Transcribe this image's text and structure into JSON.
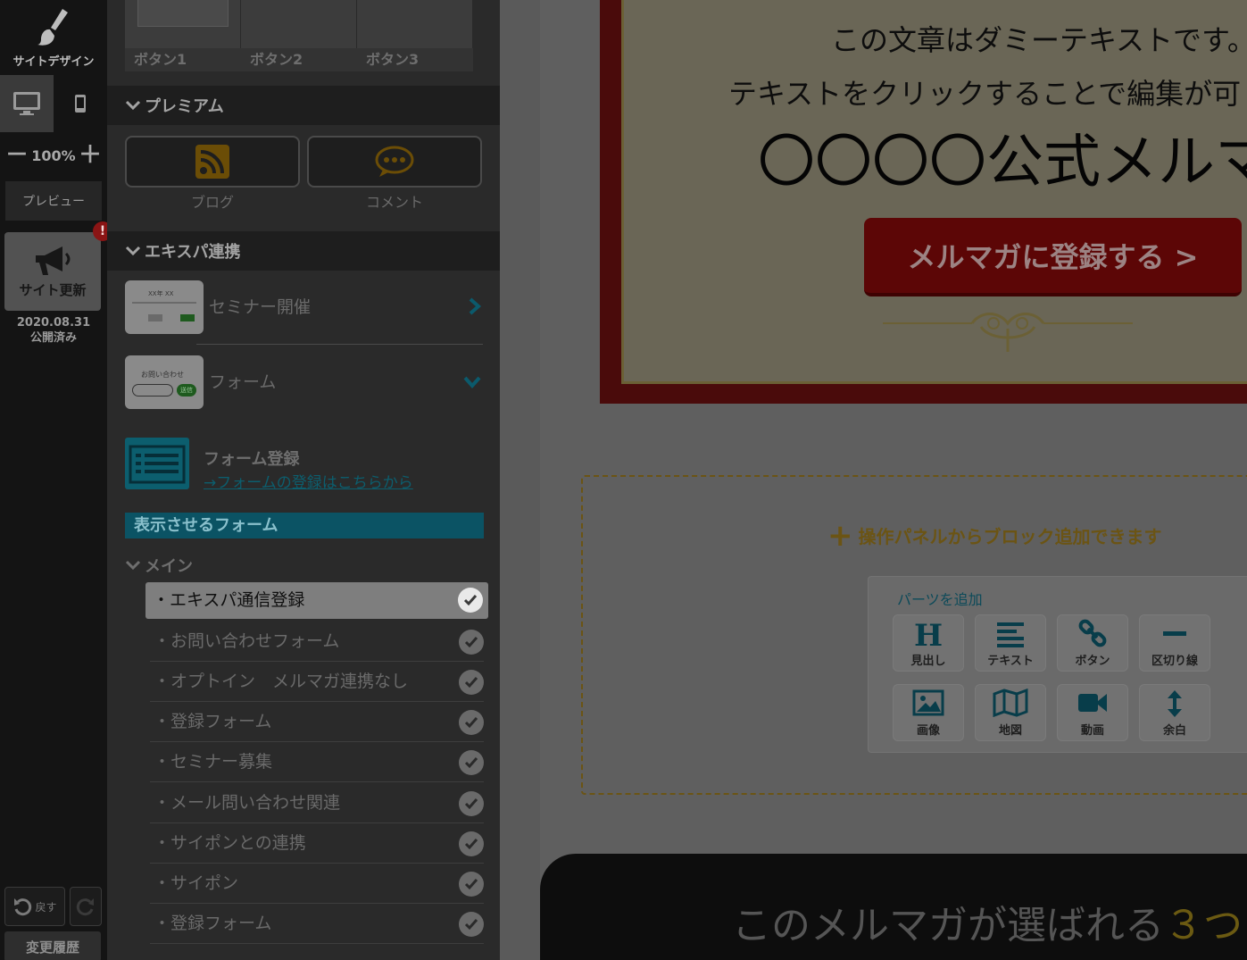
{
  "toolbar": {
    "design_label": "サイトデザイン",
    "zoom": "100%",
    "zoom_minus": "－",
    "zoom_plus": "＋",
    "preview_label": "プレビュー",
    "update_label": "サイト更新",
    "alert_badge": "!",
    "publish_date": "2020.08.31",
    "publish_status": "公開済み",
    "undo_label": "戻す",
    "history_label": "変更履歴"
  },
  "panel": {
    "button_tiles": [
      "ボタン1",
      "ボタン2",
      "ボタン3"
    ],
    "premium": {
      "heading": "プレミアム",
      "items": [
        {
          "label": "ブログ",
          "icon": "rss-icon"
        },
        {
          "label": "コメント",
          "icon": "comment-icon"
        }
      ]
    },
    "expa": {
      "heading": "エキスパ連携",
      "items": [
        {
          "label": "セミナー開催",
          "thumb_text": "XX年 XX"
        },
        {
          "label": "フォーム",
          "thumb_text": "お問い合わせ",
          "thumb_button": "送信"
        }
      ]
    },
    "form_register": {
      "title": "フォーム登録",
      "link": "→フォームの登録はこちらから"
    },
    "display_form_bar": "表示させるフォーム",
    "main_heading": "メイン",
    "forms": [
      "・エキスパ通信登録",
      "・お問い合わせフォーム",
      "・オプトイン　メルマガ連携なし",
      "・登録フォーム",
      "・セミナー募集",
      "・メール問い合わせ関連",
      "・サイポンとの連携",
      "・サイポン",
      "・登録フォーム"
    ],
    "selected_form_index": 0
  },
  "canvas": {
    "hero": {
      "line1": "この文章はダミーテキストです。",
      "line2": "テキストをクリックすることで編集が可",
      "headline": "〇〇〇〇公式メルマ",
      "cta": "メルマガに登録する >"
    },
    "drop_zone": {
      "label": "操作パネルからブロック追加できます",
      "parts_title": "パーツを追加",
      "parts": [
        {
          "label": "見出し",
          "icon": "heading-icon"
        },
        {
          "label": "テキスト",
          "icon": "text-lines-icon"
        },
        {
          "label": "ボタン",
          "icon": "link-icon"
        },
        {
          "label": "区切り線",
          "icon": "divider-icon"
        },
        {
          "label": "画像",
          "icon": "image-icon"
        },
        {
          "label": "地図",
          "icon": "map-icon"
        },
        {
          "label": "動画",
          "icon": "video-icon"
        },
        {
          "label": "余白",
          "icon": "spacing-icon"
        }
      ]
    },
    "footer": {
      "text": "このメルマガが選ばれる",
      "accent": "３つ"
    }
  },
  "colors": {
    "overlay_dim": "#000000",
    "accent_teal": "#0b5364",
    "cta_red": "#5c0606",
    "drop_gold": "#6b5414"
  }
}
